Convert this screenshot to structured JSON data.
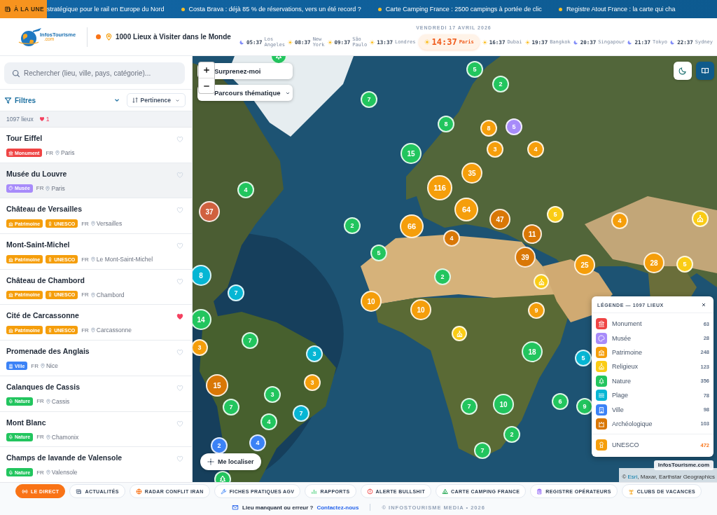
{
  "ticker": {
    "label": "À LA UNE",
    "items": [
      "stratégique pour le rail en Europe du Nord",
      "Costa Brava : déjà 85 % de réservations, vers un été record ?",
      "Carte Camping France : 2500 campings à portée de clic",
      "Registre Atout France : la carte qui cha"
    ]
  },
  "header": {
    "logo": {
      "name": "InfosTourisme",
      "suffix": ".com"
    },
    "title": "1000 Lieux à Visiter dans le Monde",
    "date": "VENDREDI 17 AVRIL 2026",
    "clocks": [
      {
        "time": "05:37",
        "city": "Los Angeles",
        "kind": "night",
        "selected": false
      },
      {
        "time": "08:37",
        "city": "New York",
        "kind": "day",
        "selected": false
      },
      {
        "time": "09:37",
        "city": "São Paulo",
        "kind": "day",
        "selected": false
      },
      {
        "time": "13:37",
        "city": "Londres",
        "kind": "day",
        "selected": false
      },
      {
        "time": "14:37",
        "city": "Paris",
        "kind": "day",
        "selected": true
      },
      {
        "time": "16:37",
        "city": "Dubai",
        "kind": "day",
        "selected": false
      },
      {
        "time": "19:37",
        "city": "Bangkok",
        "kind": "day",
        "selected": false
      },
      {
        "time": "20:37",
        "city": "Singapour",
        "kind": "night",
        "selected": false
      },
      {
        "time": "21:37",
        "city": "Tokyo",
        "kind": "night",
        "selected": false
      },
      {
        "time": "22:37",
        "city": "Sydney",
        "kind": "night",
        "selected": false
      }
    ]
  },
  "sidebar": {
    "search": {
      "placeholder": "Rechercher (lieu, ville, pays, catégorie)..."
    },
    "filters": "Filtres",
    "sort": "Pertinence",
    "count": "1097 lieux",
    "favorites_count": "1",
    "places": [
      {
        "name": "Tour Eiffel",
        "tags": [
          {
            "label": "Monument",
            "kind": "monument",
            "color": "#ef4444"
          }
        ],
        "country": "FR",
        "city": "Paris",
        "favorite": false,
        "selected": false
      },
      {
        "name": "Musée du Louvre",
        "tags": [
          {
            "label": "Musée",
            "kind": "musee",
            "color": "#a78bfa"
          }
        ],
        "country": "FR",
        "city": "Paris",
        "favorite": false,
        "selected": true
      },
      {
        "name": "Château de Versailles",
        "tags": [
          {
            "label": "Patrimoine",
            "kind": "patrimoine",
            "color": "#f59e0b"
          },
          {
            "label": "UNESCO",
            "kind": "unesco",
            "color": "#f59e0b"
          }
        ],
        "country": "FR",
        "city": "Versailles",
        "favorite": false,
        "selected": false
      },
      {
        "name": "Mont-Saint-Michel",
        "tags": [
          {
            "label": "Patrimoine",
            "kind": "patrimoine",
            "color": "#f59e0b"
          },
          {
            "label": "UNESCO",
            "kind": "unesco",
            "color": "#f59e0b"
          }
        ],
        "country": "FR",
        "city": "Le Mont-Saint-Michel",
        "favorite": false,
        "selected": false
      },
      {
        "name": "Château de Chambord",
        "tags": [
          {
            "label": "Patrimoine",
            "kind": "patrimoine",
            "color": "#f59e0b"
          },
          {
            "label": "UNESCO",
            "kind": "unesco",
            "color": "#f59e0b"
          }
        ],
        "country": "FR",
        "city": "Chambord",
        "favorite": false,
        "selected": false
      },
      {
        "name": "Cité de Carcassonne",
        "tags": [
          {
            "label": "Patrimoine",
            "kind": "patrimoine",
            "color": "#f59e0b"
          },
          {
            "label": "UNESCO",
            "kind": "unesco",
            "color": "#f59e0b"
          }
        ],
        "country": "FR",
        "city": "Carcassonne",
        "favorite": true,
        "selected": false
      },
      {
        "name": "Promenade des Anglais",
        "tags": [
          {
            "label": "Ville",
            "kind": "ville",
            "color": "#3b82f6"
          }
        ],
        "country": "FR",
        "city": "Nice",
        "favorite": false,
        "selected": false
      },
      {
        "name": "Calanques de Cassis",
        "tags": [
          {
            "label": "Nature",
            "kind": "nature",
            "color": "#22c55e"
          }
        ],
        "country": "FR",
        "city": "Cassis",
        "favorite": false,
        "selected": false
      },
      {
        "name": "Mont Blanc",
        "tags": [
          {
            "label": "Nature",
            "kind": "nature",
            "color": "#22c55e"
          }
        ],
        "country": "FR",
        "city": "Chamonix",
        "favorite": false,
        "selected": false
      },
      {
        "name": "Champs de lavande de Valensole",
        "tags": [
          {
            "label": "Nature",
            "kind": "nature",
            "color": "#22c55e"
          }
        ],
        "country": "FR",
        "city": "Valensole",
        "favorite": false,
        "selected": false
      }
    ]
  },
  "map": {
    "buttons": [
      {
        "label": "Surprenez-moi",
        "kind": "action"
      },
      {
        "label": "Parcours thématique",
        "kind": "dropdown"
      }
    ],
    "markers": [
      {
        "kind": "cluster",
        "label": "5",
        "color": "#22c55e"
      },
      {
        "kind": "cluster",
        "label": "2",
        "color": "#22c55e"
      },
      {
        "kind": "cluster",
        "label": "7",
        "color": "#22c55e"
      },
      {
        "kind": "cluster",
        "label": "8",
        "color": "#22c55e"
      },
      {
        "kind": "cluster",
        "label": "8",
        "color": "#f59e0b"
      },
      {
        "kind": "cluster",
        "label": "5",
        "color": "#a78bfa"
      },
      {
        "kind": "cluster",
        "label": "3",
        "color": "#f59e0b"
      },
      {
        "kind": "cluster",
        "label": "4",
        "color": "#f59e0b"
      },
      {
        "kind": "cluster",
        "label": "15",
        "color": "#22c55e"
      },
      {
        "kind": "cluster",
        "label": "35",
        "color": "#f59e0b"
      },
      {
        "kind": "cluster",
        "label": "116",
        "color": "#f59e0b"
      },
      {
        "kind": "cluster",
        "label": "4",
        "color": "#22c55e"
      },
      {
        "kind": "cluster",
        "label": "37",
        "color": "#d0613f"
      },
      {
        "kind": "cluster",
        "label": "64",
        "color": "#f59e0b"
      },
      {
        "kind": "cluster",
        "label": "2",
        "color": "#22c55e"
      },
      {
        "kind": "cluster",
        "label": "66",
        "color": "#f59e0b"
      },
      {
        "kind": "cluster",
        "label": "47",
        "color": "#d97706"
      },
      {
        "kind": "cluster",
        "label": "5",
        "color": "#facc15"
      },
      {
        "kind": "cluster",
        "label": "4",
        "color": "#f59e0b"
      },
      {
        "kind": "religieux",
        "color": "#facc15"
      },
      {
        "kind": "cluster",
        "label": "4",
        "color": "#d97706"
      },
      {
        "kind": "cluster",
        "label": "11",
        "color": "#d97706"
      },
      {
        "kind": "cluster",
        "label": "5",
        "color": "#22c55e"
      },
      {
        "kind": "cluster",
        "label": "39",
        "color": "#d97706"
      },
      {
        "kind": "cluster",
        "label": "25",
        "color": "#f59e0b"
      },
      {
        "kind": "cluster",
        "label": "28",
        "color": "#f59e0b"
      },
      {
        "kind": "cluster",
        "label": "5",
        "color": "#facc15"
      },
      {
        "kind": "cluster",
        "label": "8",
        "color": "#06b6d4"
      },
      {
        "kind": "religieux",
        "color": "#facc15"
      },
      {
        "kind": "cluster",
        "label": "2",
        "color": "#22c55e"
      },
      {
        "kind": "cluster",
        "label": "7",
        "color": "#06b6d4"
      },
      {
        "kind": "cluster",
        "label": "10",
        "color": "#f59e0b"
      },
      {
        "kind": "cluster",
        "label": "10",
        "color": "#f59e0b"
      },
      {
        "kind": "cluster",
        "label": "9",
        "color": "#f59e0b"
      },
      {
        "kind": "cluster",
        "label": "14",
        "color": "#22c55e"
      },
      {
        "kind": "cluster",
        "label": "7",
        "color": "#22c55e"
      },
      {
        "kind": "religieux",
        "color": "#facc15"
      },
      {
        "kind": "cluster",
        "label": "3",
        "color": "#06b6d4"
      },
      {
        "kind": "cluster",
        "label": "3",
        "color": "#f59e0b"
      },
      {
        "kind": "cluster",
        "label": "18",
        "color": "#22c55e"
      },
      {
        "kind": "cluster",
        "label": "5",
        "color": "#06b6d4"
      },
      {
        "kind": "cluster",
        "label": "15",
        "color": "#d97706"
      },
      {
        "kind": "cluster",
        "label": "3",
        "color": "#f59e0b"
      },
      {
        "kind": "cluster",
        "label": "3",
        "color": "#22c55e"
      },
      {
        "kind": "cluster",
        "label": "7",
        "color": "#22c55e"
      },
      {
        "kind": "cluster",
        "label": "7",
        "color": "#22c55e"
      },
      {
        "kind": "cluster",
        "label": "10",
        "color": "#22c55e"
      },
      {
        "kind": "cluster",
        "label": "6",
        "color": "#22c55e"
      },
      {
        "kind": "cluster",
        "label": "9",
        "color": "#22c55e"
      },
      {
        "kind": "cluster",
        "label": "4",
        "color": "#22c55e"
      },
      {
        "kind": "cluster",
        "label": "7",
        "color": "#06b6d4"
      },
      {
        "kind": "cluster",
        "label": "2",
        "color": "#22c55e"
      },
      {
        "kind": "cluster",
        "label": "2",
        "color": "#3b82f6"
      },
      {
        "kind": "cluster",
        "label": "4",
        "color": "#3b82f6"
      },
      {
        "kind": "cluster",
        "label": "7",
        "color": "#22c55e"
      },
      {
        "kind": "nature",
        "color": "#22c55e"
      },
      {
        "kind": "nature",
        "color": "#22c55e"
      }
    ],
    "locate_button": "Me localiser",
    "legend": {
      "title": "LÉGENDE — 1097 LIEUX",
      "items": [
        {
          "label": "Monument",
          "count": "63",
          "kind": "monument",
          "color": "#ef4444"
        },
        {
          "label": "Musée",
          "count": "28",
          "kind": "musee",
          "color": "#a78bfa"
        },
        {
          "label": "Patrimoine",
          "count": "248",
          "kind": "patrimoine",
          "color": "#f59e0b"
        },
        {
          "label": "Religieux",
          "count": "123",
          "kind": "religieux",
          "color": "#facc15"
        },
        {
          "label": "Nature",
          "count": "356",
          "kind": "nature",
          "color": "#22c55e"
        },
        {
          "label": "Plage",
          "count": "78",
          "kind": "plage",
          "color": "#06b6d4"
        },
        {
          "label": "Ville",
          "count": "98",
          "kind": "ville",
          "color": "#3b82f6"
        },
        {
          "label": "Archéologique",
          "count": "103",
          "kind": "archeologique",
          "color": "#d97706"
        }
      ],
      "unesco": {
        "label": "UNESCO",
        "count": "472",
        "kind": "unesco",
        "color": "#f59e0b"
      }
    },
    "brand_badge": "InfosTourisme.com",
    "attribution": {
      "symbol": "©",
      "link": "Esri",
      "text": ", Maxar, Earthstar Geographics"
    }
  },
  "footer": {
    "links": [
      {
        "label": "LE DIRECT",
        "kind": "live",
        "highlighted": true
      },
      {
        "label": "ACTUALITÉS",
        "kind": "news",
        "highlighted": false
      },
      {
        "label": "RADAR CONFLIT IRAN",
        "kind": "radar",
        "highlighted": false
      },
      {
        "label": "FICHES PRATIQUES AGV",
        "kind": "guide",
        "highlighted": false
      },
      {
        "label": "RAPPORTS",
        "kind": "reports",
        "highlighted": false
      },
      {
        "label": "ALERTE BULLSHIT",
        "kind": "alert",
        "highlighted": false
      },
      {
        "label": "CARTE CAMPING FRANCE",
        "kind": "camping",
        "highlighted": false
      },
      {
        "label": "REGISTRE OPÉRATEURS",
        "kind": "registry",
        "highlighted": false
      },
      {
        "label": "CLUBS DE VACANCES",
        "kind": "clubs",
        "highlighted": false
      }
    ],
    "contact": {
      "text": "Lieu manquant ou erreur ?",
      "link": "Contactez-nous"
    },
    "copyright": "© INFOSTOURISME MEDIA • 2026"
  }
}
